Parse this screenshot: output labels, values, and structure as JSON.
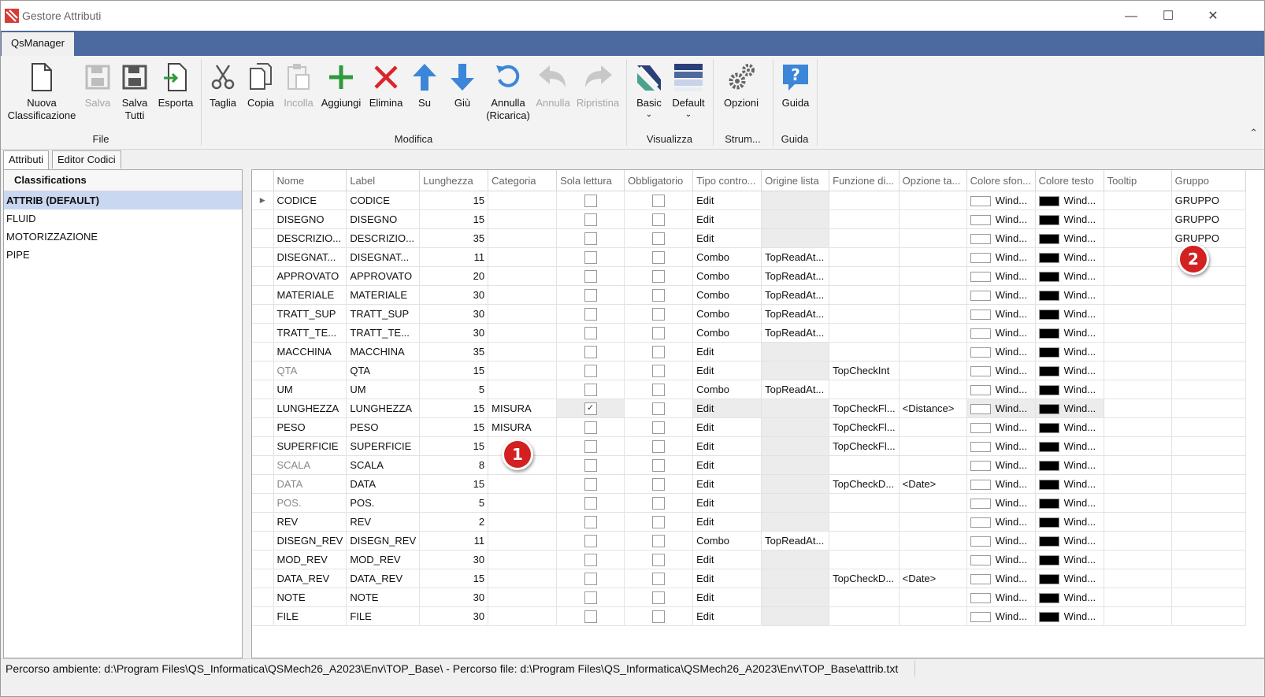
{
  "window": {
    "title": "Gestore Attributi"
  },
  "ribbon_tab": "QsManager",
  "ribbon": {
    "file": {
      "label": "File",
      "nuova1": "Nuova",
      "nuova2": "Classificazione",
      "salva": "Salva",
      "salva_tutti1": "Salva",
      "salva_tutti2": "Tutti",
      "esporta": "Esporta"
    },
    "modifica": {
      "label": "Modifica",
      "taglia": "Taglia",
      "copia": "Copia",
      "incolla": "Incolla",
      "aggiungi": "Aggiungi",
      "elimina": "Elimina",
      "su": "Su",
      "giu": "Giù",
      "annulla_ricarica1": "Annulla",
      "annulla_ricarica2": "(Ricarica)",
      "annulla": "Annulla",
      "ripristina": "Ripristina"
    },
    "visualizza": {
      "label": "Visualizza",
      "basic": "Basic",
      "default": "Default"
    },
    "strumenti": {
      "label": "Strum...",
      "opzioni": "Opzioni"
    },
    "guida": {
      "label": "Guida",
      "guida": "Guida"
    }
  },
  "tabs": {
    "attributi": "Attributi",
    "editor_codici": "Editor Codici"
  },
  "classifications": {
    "header": "Classifications",
    "items": [
      "ATTRIB (DEFAULT)",
      "FLUID",
      "MOTORIZZAZIONE",
      "PIPE"
    ]
  },
  "grid": {
    "columns": [
      "Nome",
      "Label",
      "Lunghezza",
      "Categoria",
      "Sola lettura",
      "Obbligatorio",
      "Tipo contro...",
      "Origine lista",
      "Funzione di...",
      "Opzione ta...",
      "Colore sfon...",
      "Colore testo",
      "Tooltip",
      "Gruppo"
    ],
    "rows": [
      {
        "nome": "CODICE",
        "label": "CODICE",
        "lung": "15",
        "cat": "",
        "ro": false,
        "ob": false,
        "tipo": "Edit",
        "orig": "",
        "funz": "",
        "opz": "",
        "bg": "Wind...",
        "fg": "Wind...",
        "tip": "",
        "grp": "GRUPPO",
        "gray": false,
        "current": true
      },
      {
        "nome": "DISEGNO",
        "label": "DISEGNO",
        "lung": "15",
        "cat": "",
        "ro": false,
        "ob": false,
        "tipo": "Edit",
        "orig": "",
        "funz": "",
        "opz": "",
        "bg": "Wind...",
        "fg": "Wind...",
        "tip": "",
        "grp": "GRUPPO",
        "gray": false
      },
      {
        "nome": "DESCRIZIO...",
        "label": "DESCRIZIO...",
        "lung": "35",
        "cat": "",
        "ro": false,
        "ob": false,
        "tipo": "Edit",
        "orig": "",
        "funz": "",
        "opz": "",
        "bg": "Wind...",
        "fg": "Wind...",
        "tip": "",
        "grp": "GRUPPO",
        "gray": false
      },
      {
        "nome": "DISEGNAT...",
        "label": "DISEGNAT...",
        "lung": "11",
        "cat": "",
        "ro": false,
        "ob": false,
        "tipo": "Combo",
        "orig": "TopReadAt...",
        "funz": "",
        "opz": "",
        "bg": "Wind...",
        "fg": "Wind...",
        "tip": "",
        "grp": "",
        "gray": false
      },
      {
        "nome": "APPROVATO",
        "label": "APPROVATO",
        "lung": "20",
        "cat": "",
        "ro": false,
        "ob": false,
        "tipo": "Combo",
        "orig": "TopReadAt...",
        "funz": "",
        "opz": "",
        "bg": "Wind...",
        "fg": "Wind...",
        "tip": "",
        "grp": "",
        "gray": false
      },
      {
        "nome": "MATERIALE",
        "label": "MATERIALE",
        "lung": "30",
        "cat": "",
        "ro": false,
        "ob": false,
        "tipo": "Combo",
        "orig": "TopReadAt...",
        "funz": "",
        "opz": "",
        "bg": "Wind...",
        "fg": "Wind...",
        "tip": "",
        "grp": "",
        "gray": false
      },
      {
        "nome": "TRATT_SUP",
        "label": "TRATT_SUP",
        "lung": "30",
        "cat": "",
        "ro": false,
        "ob": false,
        "tipo": "Combo",
        "orig": "TopReadAt...",
        "funz": "",
        "opz": "",
        "bg": "Wind...",
        "fg": "Wind...",
        "tip": "",
        "grp": "",
        "gray": false
      },
      {
        "nome": "TRATT_TE...",
        "label": "TRATT_TE...",
        "lung": "30",
        "cat": "",
        "ro": false,
        "ob": false,
        "tipo": "Combo",
        "orig": "TopReadAt...",
        "funz": "",
        "opz": "",
        "bg": "Wind...",
        "fg": "Wind...",
        "tip": "",
        "grp": "",
        "gray": false
      },
      {
        "nome": "MACCHINA",
        "label": "MACCHINA",
        "lung": "35",
        "cat": "",
        "ro": false,
        "ob": false,
        "tipo": "Edit",
        "orig": "",
        "funz": "",
        "opz": "",
        "bg": "Wind...",
        "fg": "Wind...",
        "tip": "",
        "grp": "",
        "gray": false
      },
      {
        "nome": "QTA",
        "label": "QTA",
        "lung": "15",
        "cat": "",
        "ro": false,
        "ob": false,
        "tipo": "Edit",
        "orig": "",
        "funz": "TopCheckInt",
        "opz": "",
        "bg": "Wind...",
        "fg": "Wind...",
        "tip": "",
        "grp": "",
        "gray": true
      },
      {
        "nome": "UM",
        "label": "UM",
        "lung": "5",
        "cat": "",
        "ro": false,
        "ob": false,
        "tipo": "Combo",
        "orig": "TopReadAt...",
        "funz": "",
        "opz": "",
        "bg": "Wind...",
        "fg": "Wind...",
        "tip": "",
        "grp": "",
        "gray": false
      },
      {
        "nome": "LUNGHEZZA",
        "label": "LUNGHEZZA",
        "lung": "15",
        "cat": "MISURA",
        "ro": true,
        "ob": false,
        "tipo": "Edit",
        "orig": "",
        "funz": "TopCheckFl...",
        "opz": "<Distance>",
        "bg": "Wind...",
        "fg": "Wind...",
        "tip": "",
        "grp": "",
        "gray": false,
        "shaded": true
      },
      {
        "nome": "PESO",
        "label": "PESO",
        "lung": "15",
        "cat": "MISURA",
        "ro": false,
        "ob": false,
        "tipo": "Edit",
        "orig": "",
        "funz": "TopCheckFl...",
        "opz": "",
        "bg": "Wind...",
        "fg": "Wind...",
        "tip": "",
        "grp": "",
        "gray": false
      },
      {
        "nome": "SUPERFICIE",
        "label": "SUPERFICIE",
        "lung": "15",
        "cat": "",
        "ro": false,
        "ob": false,
        "tipo": "Edit",
        "orig": "",
        "funz": "TopCheckFl...",
        "opz": "",
        "bg": "Wind...",
        "fg": "Wind...",
        "tip": "",
        "grp": "",
        "gray": false
      },
      {
        "nome": "SCALA",
        "label": "SCALA",
        "lung": "8",
        "cat": "",
        "ro": false,
        "ob": false,
        "tipo": "Edit",
        "orig": "",
        "funz": "",
        "opz": "",
        "bg": "Wind...",
        "fg": "Wind...",
        "tip": "",
        "grp": "",
        "gray": true
      },
      {
        "nome": "DATA",
        "label": "DATA",
        "lung": "15",
        "cat": "",
        "ro": false,
        "ob": false,
        "tipo": "Edit",
        "orig": "",
        "funz": "TopCheckD...",
        "opz": "<Date>",
        "bg": "Wind...",
        "fg": "Wind...",
        "tip": "",
        "grp": "",
        "gray": true
      },
      {
        "nome": "POS.",
        "label": "POS.",
        "lung": "5",
        "cat": "",
        "ro": false,
        "ob": false,
        "tipo": "Edit",
        "orig": "",
        "funz": "",
        "opz": "",
        "bg": "Wind...",
        "fg": "Wind...",
        "tip": "",
        "grp": "",
        "gray": true
      },
      {
        "nome": "REV",
        "label": "REV",
        "lung": "2",
        "cat": "",
        "ro": false,
        "ob": false,
        "tipo": "Edit",
        "orig": "",
        "funz": "",
        "opz": "",
        "bg": "Wind...",
        "fg": "Wind...",
        "tip": "",
        "grp": "",
        "gray": false
      },
      {
        "nome": "DISEGN_REV",
        "label": "DISEGN_REV",
        "lung": "11",
        "cat": "",
        "ro": false,
        "ob": false,
        "tipo": "Combo",
        "orig": "TopReadAt...",
        "funz": "",
        "opz": "",
        "bg": "Wind...",
        "fg": "Wind...",
        "tip": "",
        "grp": "",
        "gray": false
      },
      {
        "nome": "MOD_REV",
        "label": "MOD_REV",
        "lung": "30",
        "cat": "",
        "ro": false,
        "ob": false,
        "tipo": "Edit",
        "orig": "",
        "funz": "",
        "opz": "",
        "bg": "Wind...",
        "fg": "Wind...",
        "tip": "",
        "grp": "",
        "gray": false
      },
      {
        "nome": "DATA_REV",
        "label": "DATA_REV",
        "lung": "15",
        "cat": "",
        "ro": false,
        "ob": false,
        "tipo": "Edit",
        "orig": "",
        "funz": "TopCheckD...",
        "opz": "<Date>",
        "bg": "Wind...",
        "fg": "Wind...",
        "tip": "",
        "grp": "",
        "gray": false
      },
      {
        "nome": "NOTE",
        "label": "NOTE",
        "lung": "30",
        "cat": "",
        "ro": false,
        "ob": false,
        "tipo": "Edit",
        "orig": "",
        "funz": "",
        "opz": "",
        "bg": "Wind...",
        "fg": "Wind...",
        "tip": "",
        "grp": "",
        "gray": false
      },
      {
        "nome": "FILE",
        "label": "FILE",
        "lung": "30",
        "cat": "",
        "ro": false,
        "ob": false,
        "tipo": "Edit",
        "orig": "",
        "funz": "",
        "opz": "",
        "bg": "Wind...",
        "fg": "Wind...",
        "tip": "",
        "grp": "",
        "gray": false
      }
    ]
  },
  "status": {
    "text": "Percorso ambiente: d:\\Program Files\\QS_Informatica\\QSMech26_A2023\\Env\\TOP_Base\\  - Percorso file: d:\\Program Files\\QS_Informatica\\QSMech26_A2023\\Env\\TOP_Base\\attrib.txt"
  },
  "markers": [
    "1",
    "2"
  ],
  "colors": {
    "ribbon_blue": "#4d6aa0",
    "selection": "#c9d7f0",
    "marker_red": "#d32020"
  }
}
